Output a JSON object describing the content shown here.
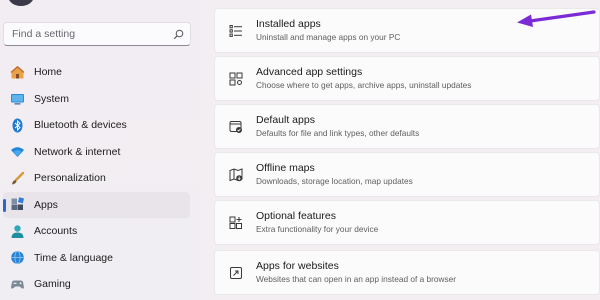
{
  "search": {
    "placeholder": "Find a setting",
    "icon": "search-icon"
  },
  "sidebar": {
    "items": [
      {
        "label": "Home",
        "icon": "home-icon"
      },
      {
        "label": "System",
        "icon": "system-icon"
      },
      {
        "label": "Bluetooth & devices",
        "icon": "bluetooth-icon"
      },
      {
        "label": "Network & internet",
        "icon": "wifi-icon"
      },
      {
        "label": "Personalization",
        "icon": "brush-icon"
      },
      {
        "label": "Apps",
        "icon": "apps-icon",
        "selected": true
      },
      {
        "label": "Accounts",
        "icon": "accounts-icon"
      },
      {
        "label": "Time & language",
        "icon": "time-language-icon"
      },
      {
        "label": "Gaming",
        "icon": "gaming-icon"
      }
    ]
  },
  "main": {
    "cards": [
      {
        "title": "Installed apps",
        "subtitle": "Uninstall and manage apps on your PC",
        "icon": "installed-apps-icon"
      },
      {
        "title": "Advanced app settings",
        "subtitle": "Choose where to get apps, archive apps, uninstall updates",
        "icon": "advanced-settings-icon"
      },
      {
        "title": "Default apps",
        "subtitle": "Defaults for file and link types, other defaults",
        "icon": "default-apps-icon"
      },
      {
        "title": "Offline maps",
        "subtitle": "Downloads, storage location, map updates",
        "icon": "offline-maps-icon"
      },
      {
        "title": "Optional features",
        "subtitle": "Extra functionality for your device",
        "icon": "optional-features-icon"
      },
      {
        "title": "Apps for websites",
        "subtitle": "Websites that can open in an app instead of a browser",
        "icon": "apps-for-websites-icon"
      }
    ]
  },
  "colors": {
    "accent": "#2e66c4",
    "annotation_arrow": "#7b2bd6"
  }
}
